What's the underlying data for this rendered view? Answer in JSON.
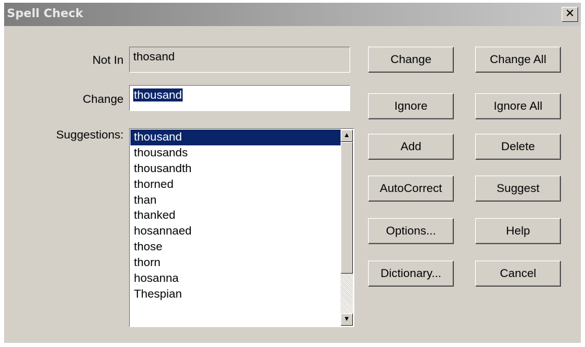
{
  "window": {
    "title": "Spell Check",
    "close_glyph": "✕"
  },
  "form": {
    "not_in_label": "Not In",
    "not_in_value": "thosand",
    "change_label": "Change",
    "change_value": "thousand",
    "suggestions_label": "Suggestions:"
  },
  "suggestions": [
    "thousand",
    "thousands",
    "thousandth",
    "thorned",
    "than",
    "thanked",
    "hosannaed",
    "those",
    "thorn",
    "hosanna",
    "Thespian"
  ],
  "selected_suggestion": "thousand",
  "buttons": {
    "change": "Change",
    "change_all": "Change All",
    "ignore": "Ignore",
    "ignore_all": "Ignore All",
    "add": "Add",
    "delete": "Delete",
    "autocorrect": "AutoCorrect",
    "suggest": "Suggest",
    "options": "Options...",
    "help": "Help",
    "dictionary": "Dictionary...",
    "cancel": "Cancel"
  },
  "colors": {
    "selection": "#0a246a",
    "dialog_face": "#d4d0c8"
  }
}
